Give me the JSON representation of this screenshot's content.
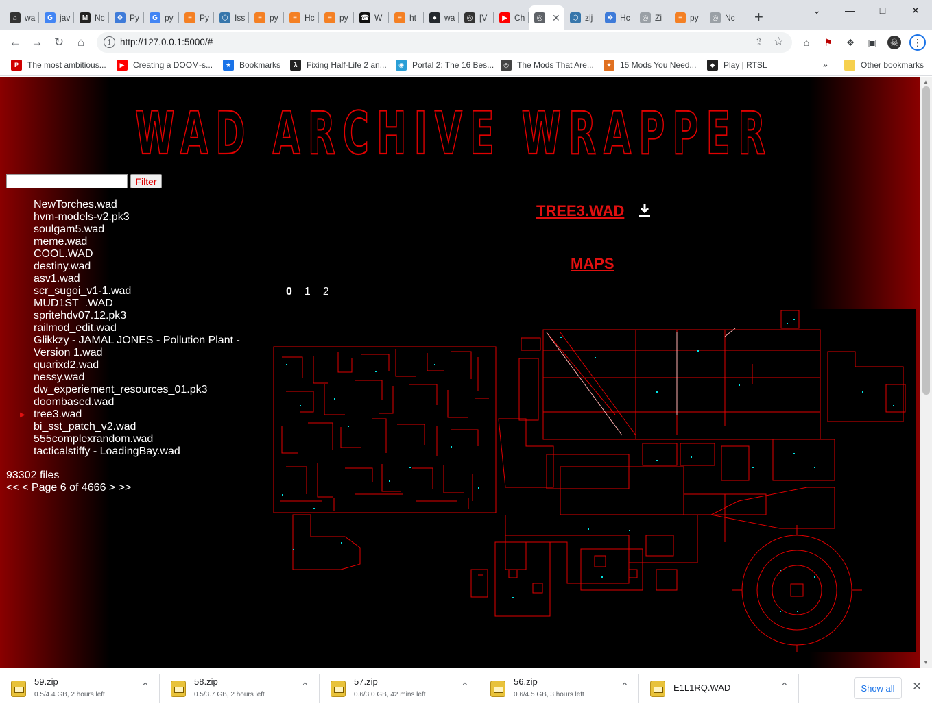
{
  "browser": {
    "tabs": [
      {
        "label": "wa",
        "icon": "bank-icon",
        "color": "#333333"
      },
      {
        "label": "jav",
        "icon": "google-icon",
        "color": "#4285f4"
      },
      {
        "label": "Nc",
        "icon": "m-logo-icon",
        "color": "#222222"
      },
      {
        "label": "Py",
        "icon": "puzzle-icon",
        "color": "#3e7bd9"
      },
      {
        "label": "py",
        "icon": "google-icon",
        "color": "#4285f4"
      },
      {
        "label": "Py",
        "icon": "stackoverflow-icon",
        "color": "#f48024"
      },
      {
        "label": "Iss",
        "icon": "python-icon",
        "color": "#3776ab"
      },
      {
        "label": "py",
        "icon": "stackoverflow-icon",
        "color": "#f48024"
      },
      {
        "label": "Hc",
        "icon": "stackoverflow-icon",
        "color": "#f48024"
      },
      {
        "label": "py",
        "icon": "stackoverflow-icon",
        "color": "#f48024"
      },
      {
        "label": "W",
        "icon": "phone-icon",
        "color": "#111111"
      },
      {
        "label": "ht",
        "icon": "stackoverflow-icon",
        "color": "#f48024"
      },
      {
        "label": "wa",
        "icon": "github-icon",
        "color": "#24292e"
      },
      {
        "label": "[V",
        "icon": "globe-icon",
        "color": "#333333"
      },
      {
        "label": "Ch",
        "icon": "youtube-icon",
        "color": "#ff0000"
      },
      {
        "label": "",
        "icon": "globe-icon",
        "color": "#5f6368",
        "active": true
      },
      {
        "label": "zij",
        "icon": "python-icon",
        "color": "#3776ab"
      },
      {
        "label": "Hc",
        "icon": "puzzle-icon",
        "color": "#3e7bd9"
      },
      {
        "label": "Zi",
        "icon": "globe-icon",
        "color": "#9aa0a6"
      },
      {
        "label": "py",
        "icon": "stackoverflow-icon",
        "color": "#f48024"
      },
      {
        "label": "Nc",
        "icon": "globe-icon",
        "color": "#9aa0a6"
      }
    ],
    "url": "http://127.0.0.1:5000/#",
    "bookmarks": [
      {
        "label": "The most ambitious...",
        "icon": "pcgamer-icon",
        "color": "#d00000"
      },
      {
        "label": "Creating a DOOM-s...",
        "icon": "youtube-icon",
        "color": "#ff0000"
      },
      {
        "label": "Bookmarks",
        "icon": "star-icon",
        "color": "#1a73e8"
      },
      {
        "label": "Fixing Half-Life 2 an...",
        "icon": "halflife-icon",
        "color": "#222222"
      },
      {
        "label": "Portal 2: The 16 Bes...",
        "icon": "portal-icon",
        "color": "#2a9fd6"
      },
      {
        "label": "The Mods That Are...",
        "icon": "globe-icon",
        "color": "#444444"
      },
      {
        "label": "15 Mods You Need...",
        "icon": "compass-icon",
        "color": "#e07020"
      },
      {
        "label": "Play | RTSL",
        "icon": "rtsl-icon",
        "color": "#222222"
      }
    ],
    "bookmarks_overflow": "»",
    "other_bookmarks": "Other bookmarks"
  },
  "page": {
    "banner_title": "WAD ARCHIVE WRAPPER",
    "filter_button": "Filter",
    "filter_value": "",
    "files": [
      {
        "name": "NewTorches.wad"
      },
      {
        "name": "hvm-models-v2.pk3"
      },
      {
        "name": "soulgam5.wad"
      },
      {
        "name": "meme.wad"
      },
      {
        "name": "COOL.WAD"
      },
      {
        "name": "destiny.wad"
      },
      {
        "name": "asv1.wad"
      },
      {
        "name": "scr_sugoi_v1-1.wad"
      },
      {
        "name": "MUD1ST_.WAD"
      },
      {
        "name": "spritehdv07.12.pk3"
      },
      {
        "name": "railmod_edit.wad"
      },
      {
        "name": "Glikkzy - JAMAL JONES - Pollution Plant -"
      },
      {
        "name": "Version 1.wad"
      },
      {
        "name": "quarixd2.wad"
      },
      {
        "name": "nessy.wad"
      },
      {
        "name": "dw_experiement_resources_01.pk3"
      },
      {
        "name": "doombased.wad"
      },
      {
        "name": "tree3.wad",
        "selected": true
      },
      {
        "name": "bi_sst_patch_v2.wad"
      },
      {
        "name": "555complexrandom.wad"
      },
      {
        "name": "tacticalstiffy - LoadingBay.wad"
      }
    ],
    "file_count": "93302 files",
    "pager": "<< < Page 6 of 4666 > >>",
    "wad_title": "TREE3.WAD",
    "maps_heading": "MAPS",
    "map_tabs": [
      {
        "label": "0",
        "active": true
      },
      {
        "label": "1"
      },
      {
        "label": "2"
      }
    ],
    "colors": {
      "accent": "#e01010",
      "map_line": "#e00000",
      "thing": "#00e5e5"
    }
  },
  "downloads": [
    {
      "name": "59.zip",
      "status": "0.5/4.4 GB, 2 hours left"
    },
    {
      "name": "58.zip",
      "status": "0.5/3.7 GB, 2 hours left"
    },
    {
      "name": "57.zip",
      "status": "0.6/3.0 GB, 42 mins left"
    },
    {
      "name": "56.zip",
      "status": "0.6/4.5 GB, 3 hours left"
    },
    {
      "name": "E1L1RQ.WAD",
      "status": ""
    }
  ],
  "shelf": {
    "show_all": "Show all"
  }
}
